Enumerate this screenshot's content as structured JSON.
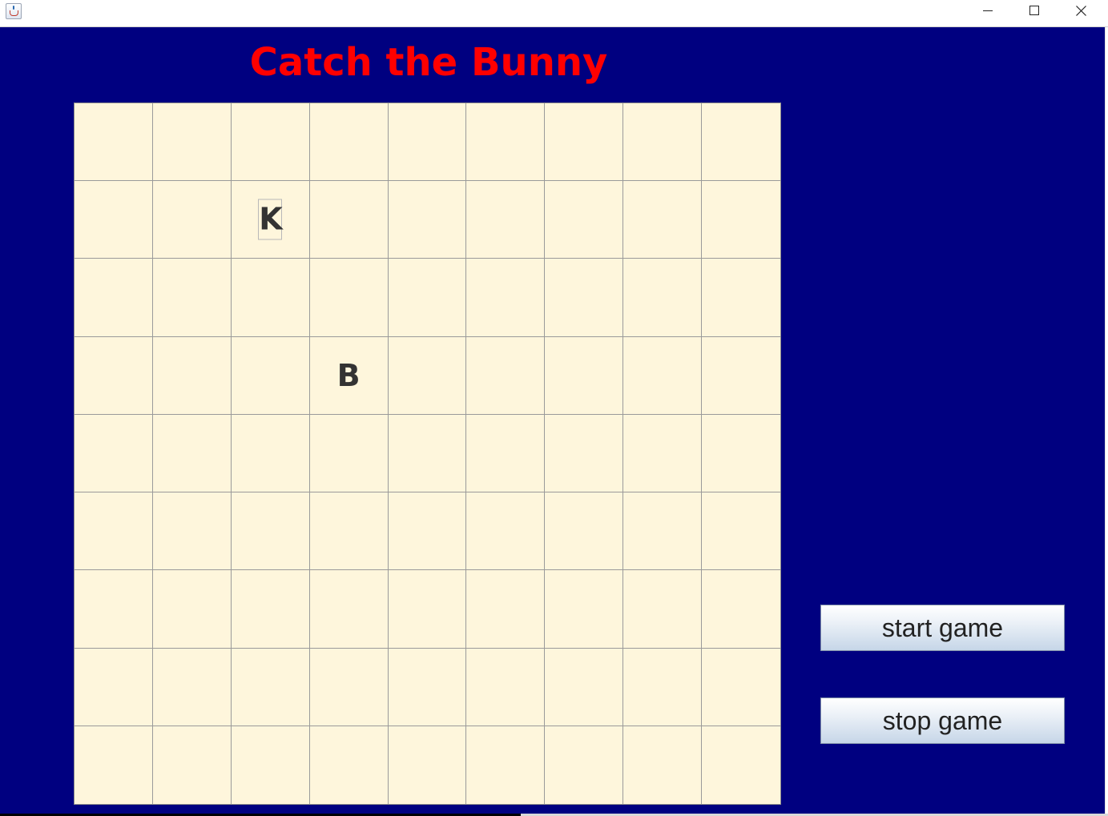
{
  "window": {
    "icon": "java-cup-icon",
    "controls": [
      "minimize-icon",
      "maximize-icon",
      "close-icon"
    ]
  },
  "game": {
    "title": "Catch the Bunny",
    "grid_size": 9,
    "pieces": [
      {
        "label": "K",
        "row": 1,
        "col": 2,
        "focused": true
      },
      {
        "label": "B",
        "row": 3,
        "col": 3,
        "focused": false
      }
    ]
  },
  "controls": {
    "start_label": "start game",
    "stop_label": "stop game"
  },
  "colors": {
    "background": "#000080",
    "title": "#ff0000",
    "cell": "#fef6dc",
    "piece_text": "#333333"
  }
}
